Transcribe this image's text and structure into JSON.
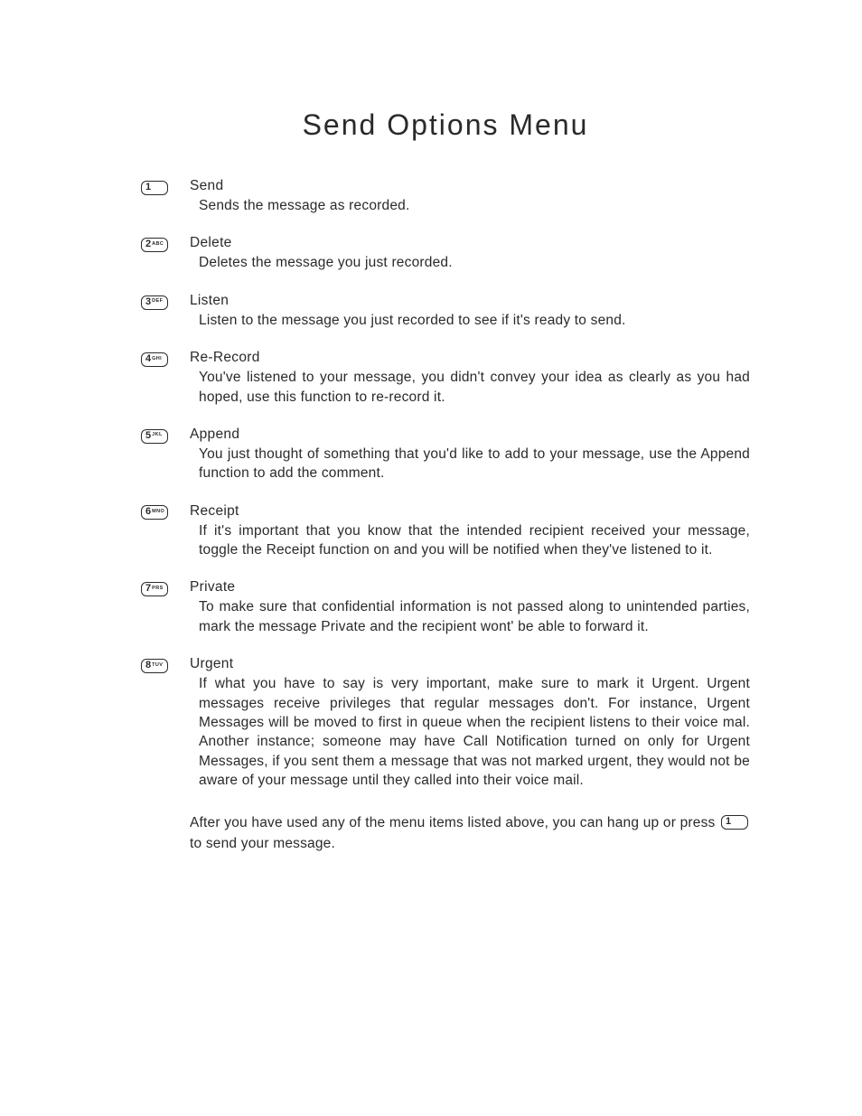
{
  "title": "Send Options Menu",
  "options": [
    {
      "digit": "1",
      "letters": "",
      "name": "Send",
      "desc": "Sends the message as recorded."
    },
    {
      "digit": "2",
      "letters": "ABC",
      "name": "Delete",
      "desc": "Deletes the message you just recorded."
    },
    {
      "digit": "3",
      "letters": "DEF",
      "name": "Listen",
      "desc": "Listen to the message you just recorded to see if it's ready to send."
    },
    {
      "digit": "4",
      "letters": "GHI",
      "name": "Re-Record",
      "desc": "You've listened to your message, you didn't convey your idea as clearly as you had hoped, use this function to re-record it."
    },
    {
      "digit": "5",
      "letters": "JKL",
      "name": "Append",
      "desc": "You just thought of something that you'd like to add to your message, use the Append function to add the comment."
    },
    {
      "digit": "6",
      "letters": "MNO",
      "name": "Receipt",
      "desc": "If it's important that you know that the intended recipient received your message, toggle the Receipt function on and you will be notified when they've listened to it."
    },
    {
      "digit": "7",
      "letters": "PRS",
      "name": "Private",
      "desc": "To make sure that confidential information is not passed along to unintended parties, mark the message Private and the recipient wont' be able to forward it."
    },
    {
      "digit": "8",
      "letters": "TUV",
      "name": "Urgent",
      "desc": "If what you have to say is very important, make sure to mark it Urgent.  Urgent messages receive privileges that regular messages don't.  For instance, Urgent Messages will be moved to first in queue when the recipient listens to their voice mal.  Another instance; someone may have Call Notification turned on only for Urgent Messages, if you sent them a message that was not marked urgent, they would not be aware of your message until they called into their voice mail."
    }
  ],
  "footer": {
    "pre": "After you have used any of the menu items listed above, you can hang up or press ",
    "key_digit": "1",
    "key_letters": "",
    "post": " to send your message."
  }
}
